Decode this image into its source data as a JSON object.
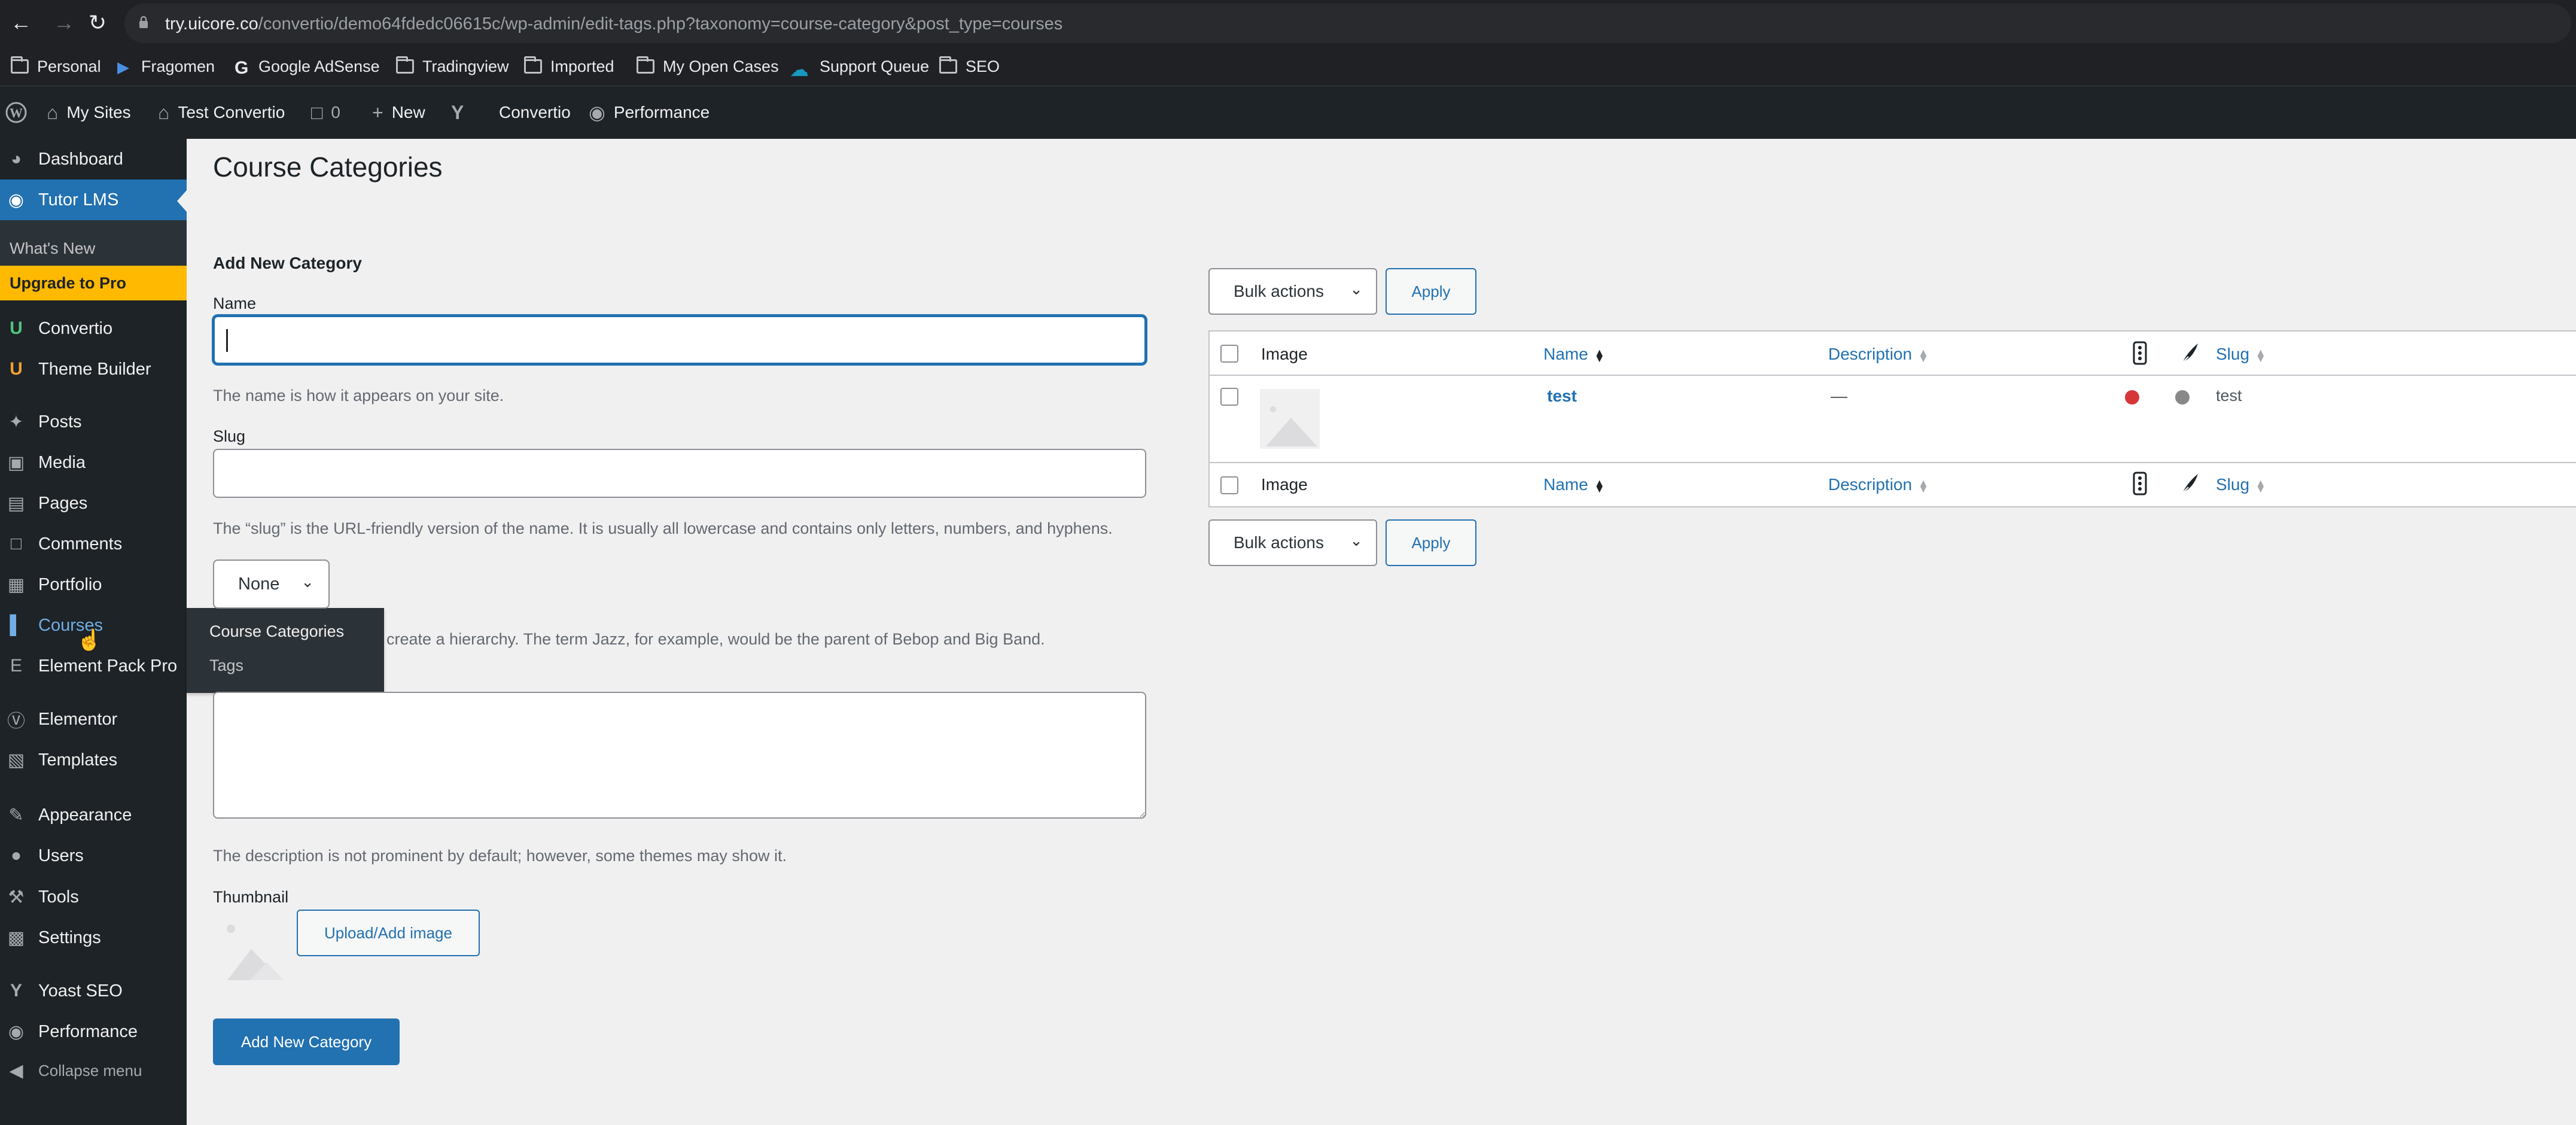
{
  "browser": {
    "url_host": "try.uicore.co",
    "url_path": "/convertio/demo64fdedc06615c/wp-admin/edit-tags.php?taxonomy=course-category&post_type=courses",
    "bookmarks": [
      "Personal",
      "Fragomen",
      "Google AdSense",
      "Tradingview",
      "Imported",
      "My Open Cases",
      "Support Queue",
      "SEO"
    ]
  },
  "adminbar": {
    "my_sites": "My Sites",
    "site_name": "Test Convertio",
    "comments_count": "0",
    "new": "New",
    "convertio": "Convertio",
    "performance": "Performance"
  },
  "sidebar": {
    "dashboard": "Dashboard",
    "tutor_lms": "Tutor LMS",
    "whats_new": "What's New",
    "upgrade": "Upgrade to Pro",
    "convertio": "Convertio",
    "theme_builder": "Theme Builder",
    "posts": "Posts",
    "media": "Media",
    "pages": "Pages",
    "comments": "Comments",
    "portfolio": "Portfolio",
    "courses": "Courses",
    "element_pack": "Element Pack Pro",
    "elementor": "Elementor",
    "templates": "Templates",
    "appearance": "Appearance",
    "users": "Users",
    "tools": "Tools",
    "settings": "Settings",
    "yoast": "Yoast SEO",
    "performance": "Performance",
    "collapse": "Collapse menu",
    "flyout": [
      "Course Categories",
      "Tags"
    ]
  },
  "main": {
    "title": "Course Categories",
    "form": {
      "heading": "Add New Category",
      "name_label": "Name",
      "name_value": "",
      "name_help": "The name is how it appears on your site.",
      "slug_label": "Slug",
      "slug_value": "",
      "slug_help": "The “slug” is the URL-friendly version of the name. It is usually all lowercase and contains only letters, numbers, and hyphens.",
      "parent_value": "None",
      "parent_help_visible": "create a hierarchy. The term Jazz, for example, would be the parent of Bebop and Big Band.",
      "description_value": "",
      "description_help": "The description is not prominent by default; however, some themes may show it.",
      "thumbnail_label": "Thumbnail",
      "upload_button": "Upload/Add image",
      "submit_button": "Add New Category"
    },
    "table": {
      "bulk_actions": "Bulk actions",
      "apply": "Apply",
      "columns": {
        "image": "Image",
        "name": "Name",
        "description": "Description",
        "slug": "Slug"
      },
      "rows": [
        {
          "name": "test",
          "description": "—",
          "slug": "test",
          "seo_status_color": "#d63638",
          "readability_color": "#888888"
        }
      ]
    }
  },
  "colors": {
    "wp_blue": "#2271b1",
    "admin_dark": "#1d2327",
    "upgrade_yellow": "#ffb900"
  }
}
